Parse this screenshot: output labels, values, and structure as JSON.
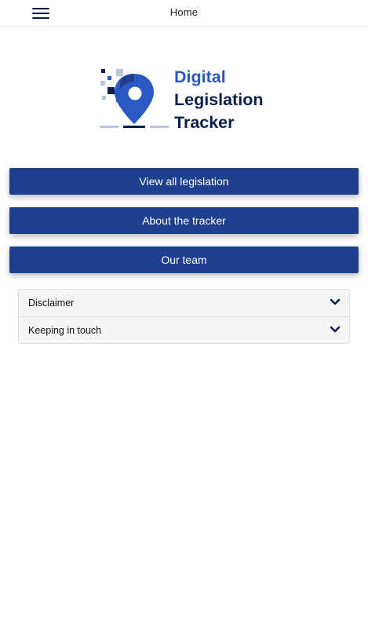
{
  "app_bar": {
    "title": "Home",
    "menu_icon": "hamburger-menu-icon"
  },
  "logo": {
    "line1": "Digital",
    "line2": "Legislation",
    "line3": "Tracker",
    "colors": {
      "accent": "#2b59c3",
      "dark": "#0b1f4d",
      "pixel_light": "#b9c6d6"
    }
  },
  "nav_buttons": [
    {
      "label": "View all legislation"
    },
    {
      "label": "About the tracker"
    },
    {
      "label": "Our team"
    }
  ],
  "accordion": [
    {
      "label": "Disclaimer",
      "icon": "chevron-down-icon"
    },
    {
      "label": "Keeping in touch",
      "icon": "chevron-down-icon"
    }
  ],
  "colors": {
    "button_bg": "#1e3f8c",
    "button_text": "#ffffff",
    "accordion_bg": "#f5f5f5"
  }
}
